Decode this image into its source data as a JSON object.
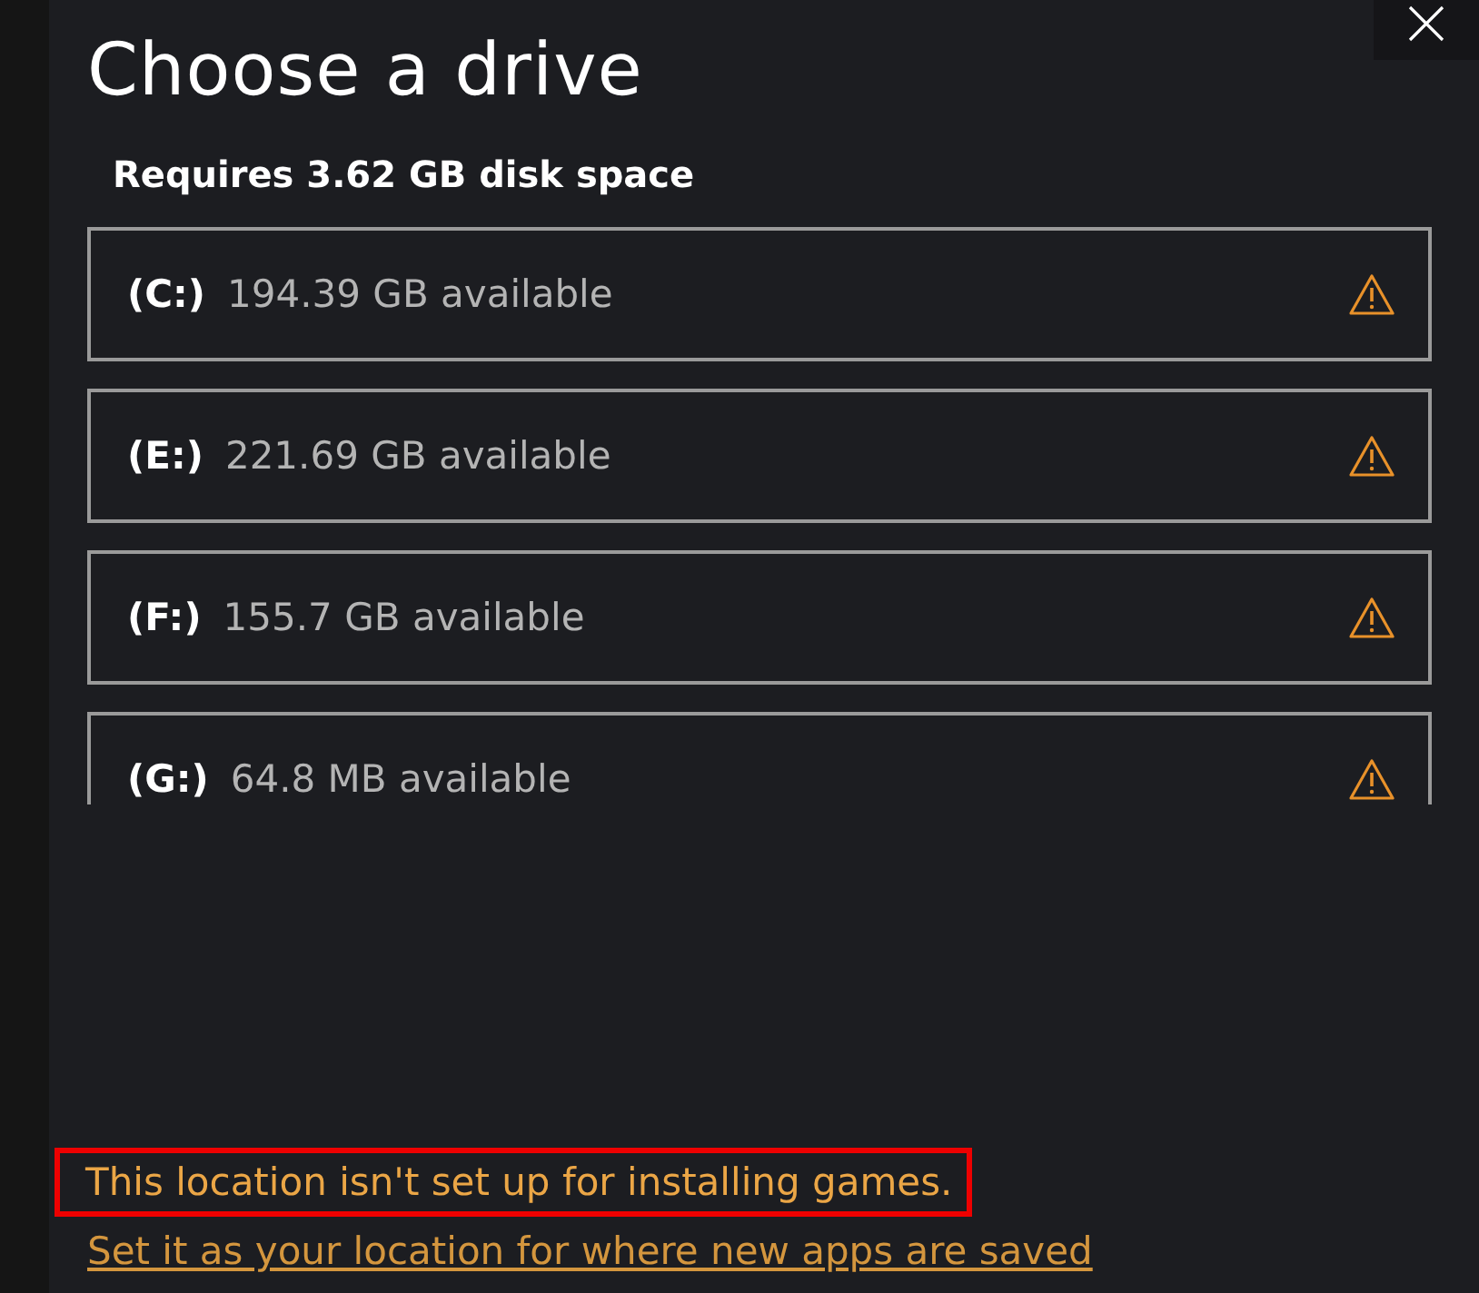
{
  "title": "Choose a drive",
  "requirement": "Requires 3.62 GB disk space",
  "drives": [
    {
      "letter": "(C:)",
      "available": "194.39 GB available"
    },
    {
      "letter": "(E:)",
      "available": "221.69 GB available"
    },
    {
      "letter": "(F:)",
      "available": "155.7 GB available"
    },
    {
      "letter": "(G:)",
      "available": "64.8 MB available"
    }
  ],
  "warning": "This location isn't set up for installing games.",
  "link": "Set it as your location for where new apps are saved"
}
